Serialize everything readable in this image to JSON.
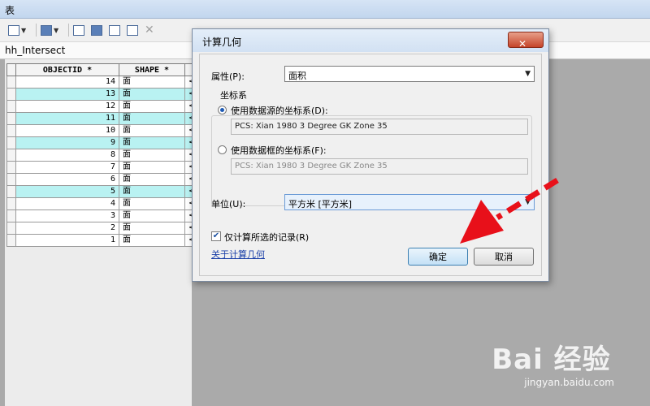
{
  "window": {
    "title": "表"
  },
  "tab": {
    "title": "hh_Intersect"
  },
  "table": {
    "columns": [
      "OBJECTID *",
      "SHAPE *"
    ],
    "truncated_cell": "<空",
    "rows": [
      {
        "oid": "14",
        "shape": "面",
        "highlight": false
      },
      {
        "oid": "13",
        "shape": "面",
        "highlight": true
      },
      {
        "oid": "12",
        "shape": "面",
        "highlight": false
      },
      {
        "oid": "11",
        "shape": "面",
        "highlight": true
      },
      {
        "oid": "10",
        "shape": "面",
        "highlight": false
      },
      {
        "oid": "9",
        "shape": "面",
        "highlight": true
      },
      {
        "oid": "8",
        "shape": "面",
        "highlight": false
      },
      {
        "oid": "7",
        "shape": "面",
        "highlight": false
      },
      {
        "oid": "6",
        "shape": "面",
        "highlight": false
      },
      {
        "oid": "5",
        "shape": "面",
        "highlight": true
      },
      {
        "oid": "4",
        "shape": "面",
        "highlight": false
      },
      {
        "oid": "3",
        "shape": "面",
        "highlight": false
      },
      {
        "oid": "2",
        "shape": "面",
        "highlight": false
      },
      {
        "oid": "1",
        "shape": "面",
        "highlight": false
      }
    ]
  },
  "dialog": {
    "title": "计算几何",
    "close_label": "✕",
    "property_label": "属性(P):",
    "property_value": "面积",
    "coord_group_label": "坐标系",
    "use_source_label": "使用数据源的坐标系(D):",
    "source_cs": "PCS: Xian 1980 3 Degree GK Zone 35",
    "use_frame_label": "使用数据框的坐标系(F):",
    "frame_cs": "PCS: Xian 1980 3 Degree GK Zone 35",
    "unit_label": "单位(U):",
    "unit_value": "平方米 [平方米]",
    "selected_only_label": "仅计算所选的记录(R)",
    "about_link": "关于计算几何",
    "ok_label": "确定",
    "cancel_label": "取消"
  },
  "watermark": {
    "brand": "Bai 经验",
    "url": "jingyan.baidu.com"
  },
  "colors": {
    "row_highlight": "#b9f2f2",
    "arrow": "#e8101a",
    "accent": "#1e5ab4"
  }
}
